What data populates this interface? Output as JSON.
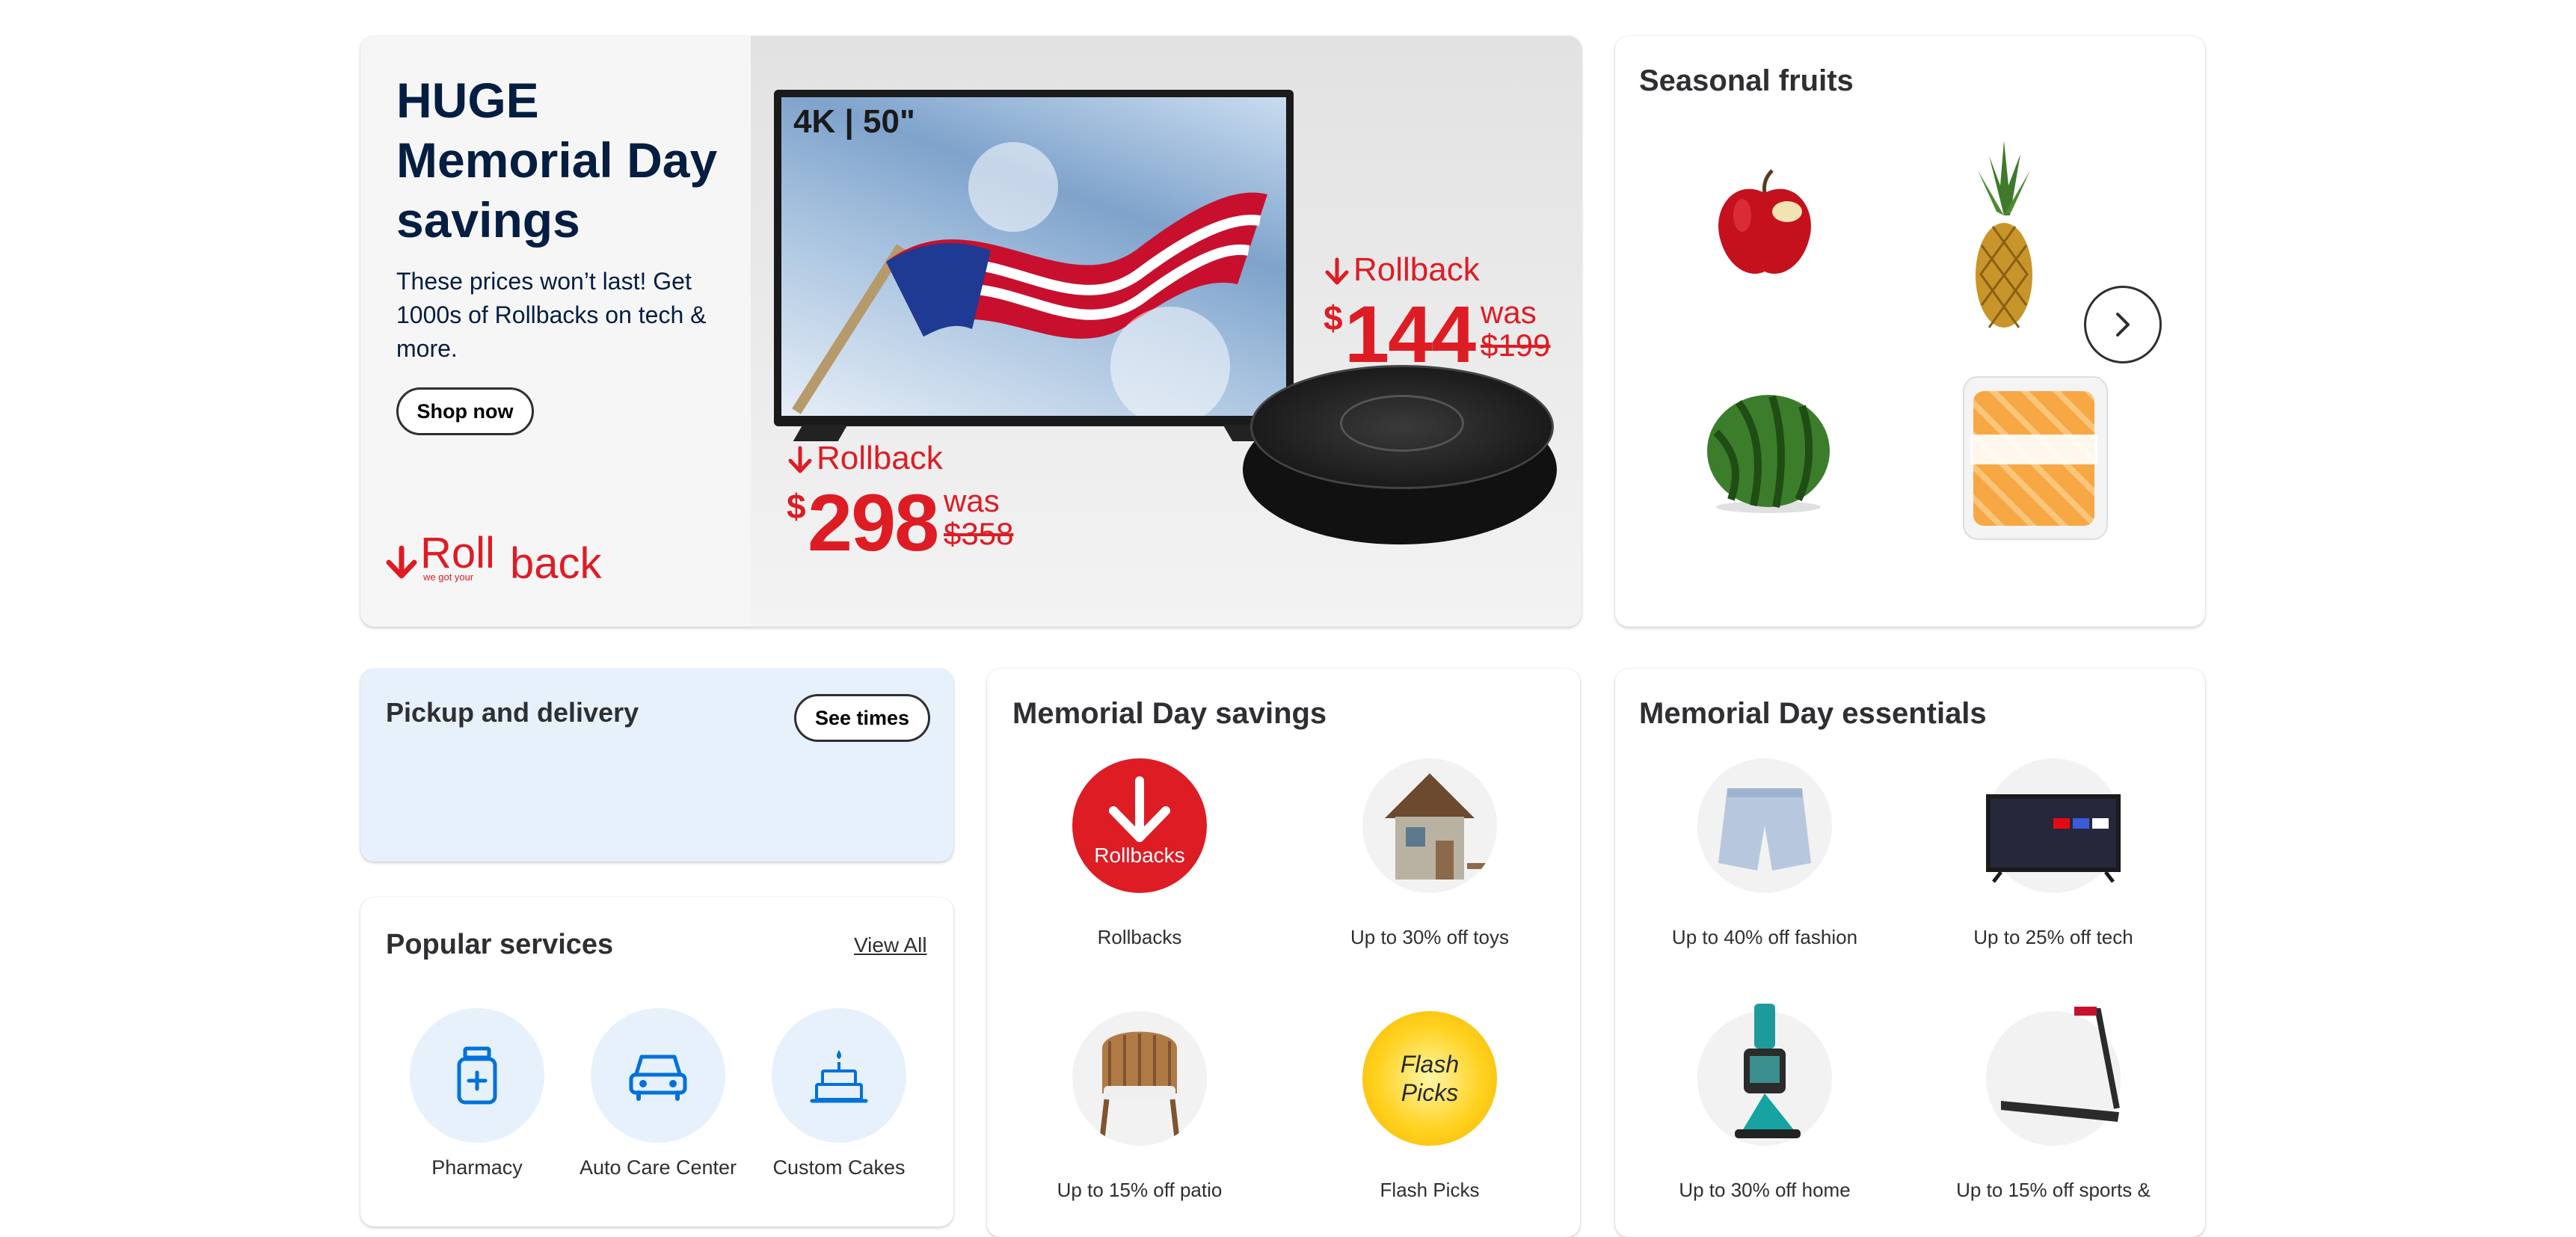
{
  "hero": {
    "title_line1": "HUGE",
    "title_line2": "Memorial Day",
    "title_line3": "savings",
    "subtitle": "These prices won’t last! Get 1000s of Rollbacks on tech & more.",
    "button": "Shop now",
    "logo_roll": "Roll",
    "logo_back": "back",
    "logo_tag": "we got your",
    "tv_badge": "4K | 50\"",
    "price1": {
      "label": "Rollback",
      "currency": "$",
      "amount": "298",
      "was": "was",
      "was_price": "$358"
    },
    "price2": {
      "label": "Rollback",
      "currency": "$",
      "amount": "144",
      "was": "was",
      "was_price": "$199"
    }
  },
  "seasonal": {
    "title": "Seasonal fruits",
    "items": [
      "apple",
      "pineapple",
      "watermelon",
      "cantaloupe chunks"
    ]
  },
  "pickup": {
    "title": "Pickup and delivery",
    "button": "See times"
  },
  "services": {
    "title": "Popular services",
    "view_all": "View All",
    "items": [
      {
        "label": "Pharmacy",
        "icon": "pill-bottle-icon"
      },
      {
        "label": "Auto Care Center",
        "icon": "car-icon"
      },
      {
        "label": "Custom Cakes",
        "icon": "cake-icon"
      }
    ]
  },
  "savings": {
    "title": "Memorial Day savings",
    "items": [
      {
        "label": "Rollbacks",
        "badge": "Rollbacks"
      },
      {
        "label": "Up to 30% off toys"
      },
      {
        "label": "Up to 15% off patio"
      },
      {
        "label": "Flash Picks",
        "badge": "Flash Picks"
      }
    ]
  },
  "essentials": {
    "title": "Memorial Day essentials",
    "items": [
      {
        "label": "Up to 40% off fashion"
      },
      {
        "label": "Up to 25% off tech"
      },
      {
        "label": "Up to 30% off home"
      },
      {
        "label": "Up to 15% off sports &"
      }
    ]
  },
  "colors": {
    "navy": "#041e42",
    "rollback_red": "#de1c24",
    "blue_icon": "#0071dc",
    "light_blue": "#e6f1fc"
  }
}
